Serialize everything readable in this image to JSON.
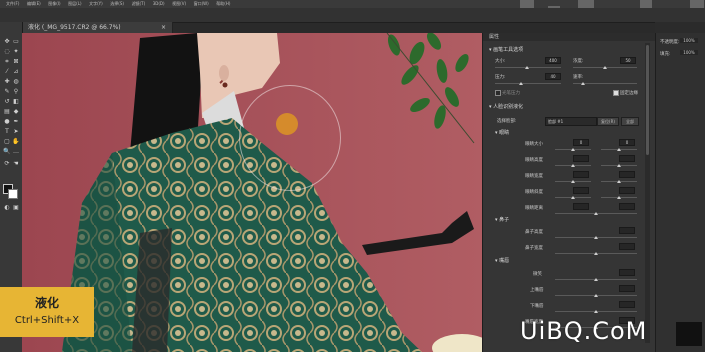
{
  "menubar": {
    "items": [
      "文件(F)",
      "编辑(E)",
      "图像(I)",
      "图层(L)",
      "文字(Y)",
      "选择(S)",
      "滤镜(T)",
      "3D(D)",
      "视图(V)",
      "窗口(W)",
      "帮助(H)"
    ]
  },
  "document": {
    "tab_title": "液化 (_MG_9517.CR2 @ 66.7%)",
    "close": "×"
  },
  "panel": {
    "title": "属性",
    "brush_section": "画笔工具选项",
    "size_label": "大小:",
    "size_value": "400",
    "density_label": "浓度:",
    "density_value": "50",
    "pressure_label": "压力:",
    "pressure_value": "40",
    "rate_label": "速率:",
    "stylus_label": "光笔压力",
    "pin_edges_label": "固定边缘",
    "face_section": "人脸识别液化",
    "select_face_label": "选择脸部:",
    "select_face_value": "脸部 #1",
    "reset_button": "复位(R)",
    "all_button": "全部",
    "eyes_section": "眼睛",
    "eyes_rows": [
      {
        "label": "眼睛大小",
        "left": "0",
        "right": "0"
      },
      {
        "label": "眼睛高度",
        "left": "",
        "right": ""
      },
      {
        "label": "眼睛宽度",
        "left": "",
        "right": ""
      },
      {
        "label": "眼睛斜度",
        "left": "",
        "right": ""
      },
      {
        "label": "眼睛距离",
        "left": "",
        "right": ""
      }
    ],
    "nose_section": "鼻子",
    "nose_rows": [
      {
        "label": "鼻子高度",
        "value": ""
      },
      {
        "label": "鼻子宽度",
        "value": ""
      }
    ],
    "mouth_section": "嘴唇",
    "mouth_rows": [
      {
        "label": "微笑",
        "value": ""
      },
      {
        "label": "上嘴唇",
        "value": ""
      },
      {
        "label": "下嘴唇",
        "value": ""
      },
      {
        "label": "嘴唇宽度",
        "value": ""
      }
    ]
  },
  "right_panel": {
    "rows": [
      {
        "label": "不透明度:",
        "value": "100%"
      },
      {
        "label": "填充:",
        "value": "100%"
      }
    ]
  },
  "overlay": {
    "title": "液化",
    "shortcut": "Ctrl+Shift+X"
  },
  "watermark": {
    "text": "UiBQ.CoM"
  },
  "colors": {
    "canvas_bg": "#a54c55",
    "robe": "#1f5a4a",
    "label_bg": "#e7b534",
    "brush_dot": "#d58b2c"
  }
}
